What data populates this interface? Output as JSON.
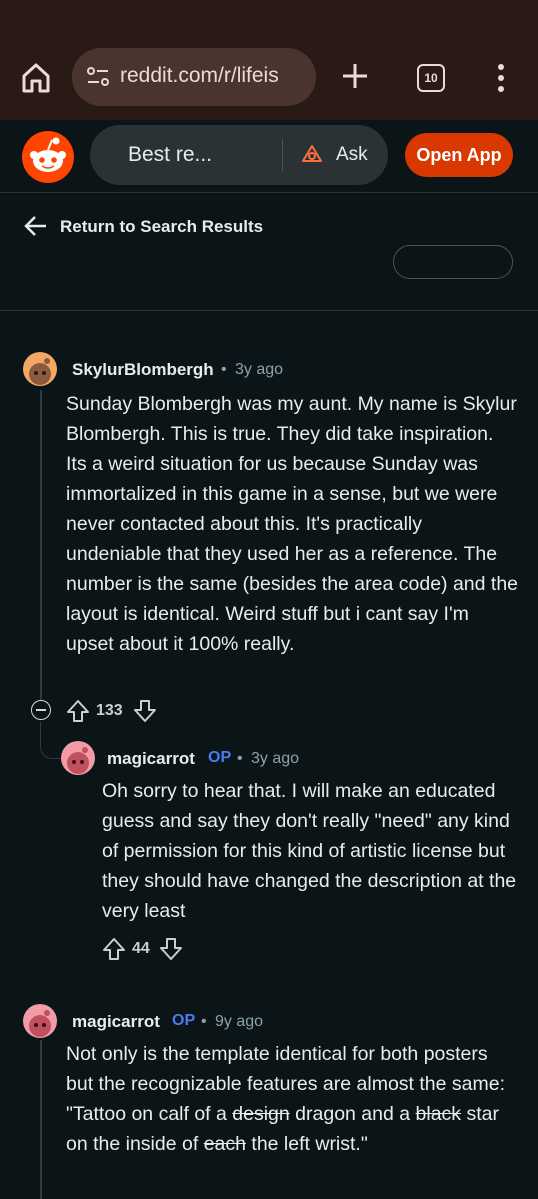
{
  "browser": {
    "url": "reddit.com/r/lifeis",
    "tab_count": "10"
  },
  "reddit_bar": {
    "search_query": "Best re...",
    "ask_label": "Ask",
    "open_app_label": "Open App",
    "accent_color": "#d93900"
  },
  "back": {
    "label": "Return to Search Results"
  },
  "comments": [
    {
      "username": "SkylurBlombergh",
      "dot": "•",
      "age": "3y ago",
      "body": "Sunday Blombergh was my aunt. My name is Skylur Blombergh. This is true. They did take inspiration. Its a weird situation for us because Sunday was immortalized in this game in a sense, but we were never contacted about this. It's practically undeniable that they used her as a reference. The number is the same (besides the area code) and the layout is identical. Weird stuff but i cant say I'm upset about it 100% really.",
      "score": "133"
    },
    {
      "username": "magicarrot",
      "op": "OP",
      "dot": "•",
      "age": "3y ago",
      "body": "Oh sorry to hear that. I will make an educated guess and say they don't really \"need\" any kind of permission for this kind of artistic license but they should have changed the description at the very least",
      "score": "44"
    },
    {
      "username": "magicarrot",
      "op": "OP",
      "dot": "•",
      "age": "9y ago",
      "body_parts": [
        "Not only is the template identical for both posters but the recognizable features are almost the same: \"Tattoo on calf of a ",
        "design",
        " dragon and a ",
        "black",
        " star on the inside of ",
        "each",
        " the left wrist.\""
      ]
    }
  ]
}
